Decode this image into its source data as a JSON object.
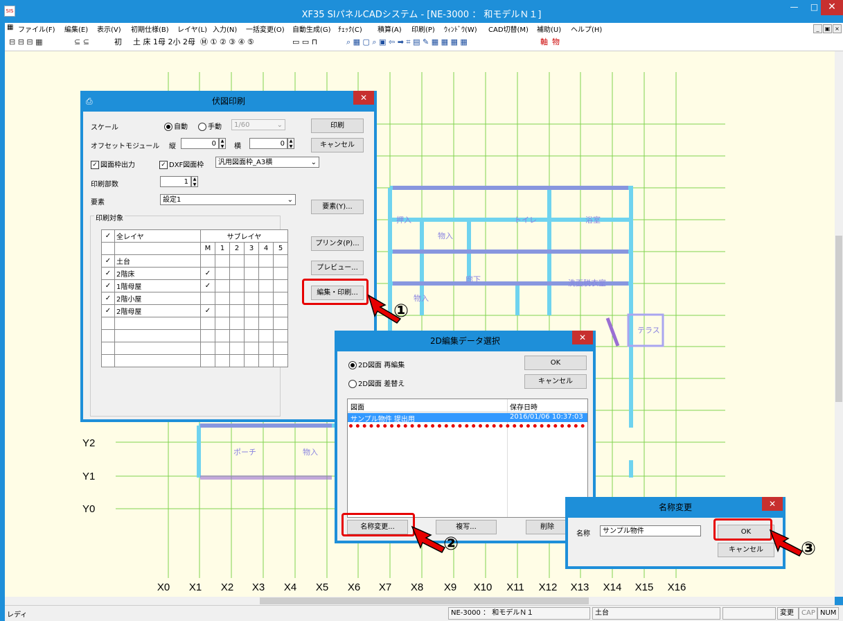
{
  "window": {
    "title": "XF35 SIパネルCADシステム - [NE-3000 ： 和モデルＮ１]",
    "app_icon": "cad-app-icon"
  },
  "menu": [
    "ファイル(F)",
    "編集(E)",
    "表示(V)",
    "初期仕様(B)",
    "レイヤ(L)",
    "入力(N)",
    "一括変更(O)",
    "自動生成(G)",
    "ﾁｪｯｸ(C)",
    "積算(A)",
    "印刷(P)",
    "ｳｨﾝﾄﾞｳ(W)",
    "CAD切替(M)",
    "補助(U)",
    "ヘルプ(H)"
  ],
  "toolbar": {
    "group1": "⊟ ⊟ ⊟ ▦",
    "group2": "⊆ ⊆",
    "item_init": "初",
    "group3": "土 床 1母 2小 2母",
    "group4": "Ⓜ ① ② ③ ④ ⑤",
    "group5": "▭ ▭ ⊓",
    "group6": "⌕ ▦ ▢ ⌕ ▣ ⇦ ➡ ⌗ ▤ ✎ ▦ ▦ ▦ ▦",
    "item_shaft": "軸",
    "item_thing": "物"
  },
  "canvas": {
    "y_labels": [
      "Y2",
      "Y1",
      "Y0"
    ],
    "x_labels": [
      "X0",
      "X1",
      "X2",
      "X3",
      "X4",
      "X5",
      "X6",
      "X7",
      "X8",
      "X9",
      "X10",
      "X11",
      "X12",
      "X13",
      "X14",
      "X15",
      "X16"
    ],
    "room_labels": [
      "押入",
      "物入",
      "トイレ",
      "浴室",
      "廊下",
      "洗面脱衣室",
      "物入",
      "テラス",
      "ポーチ",
      "物入"
    ]
  },
  "dlg_print": {
    "title": "伏図印刷",
    "scale_label": "スケール",
    "radio_auto": "自動",
    "radio_manual": "手動",
    "scale_value": "1/60",
    "offset_label": "オフセットモジュール",
    "vert_label": "縦",
    "vert_value": "0",
    "horz_label": "横",
    "horz_value": "0",
    "frame_output": "図面枠出力",
    "dxf_frame": "DXF図面枠",
    "frame_select": "汎用図面枠_A3横",
    "copies_label": "印刷部数",
    "copies_value": "1",
    "element_label": "要素",
    "element_select": "設定1",
    "target_group": "印刷対象",
    "all_layers": "全レイヤ",
    "sublayer": "サブレイヤ",
    "sub_cols": [
      "M",
      "1",
      "2",
      "3",
      "4",
      "5"
    ],
    "layers": [
      {
        "name": "土台",
        "checked": "✓",
        "m": ""
      },
      {
        "name": "2階床",
        "checked": "✓",
        "m": "✓"
      },
      {
        "name": "1階母屋",
        "checked": "✓",
        "m": "✓"
      },
      {
        "name": "2階小屋",
        "checked": "✓",
        "m": ""
      },
      {
        "name": "2階母屋",
        "checked": "✓",
        "m": "✓"
      }
    ],
    "btn_print": "印刷",
    "btn_cancel": "キャンセル",
    "btn_element": "要素(Y)...",
    "btn_printer": "プリンタ(P)...",
    "btn_preview": "プレビュー...",
    "btn_edit_print": "編集・印刷..."
  },
  "dlg_edit": {
    "title": "2D編集データ選択",
    "radio_reedit": "2D図面 再編集",
    "radio_replace": "2D図面 差替え",
    "btn_ok": "OK",
    "btn_cancel": "キャンセル",
    "col_drawing": "図面",
    "col_saved": "保存日時",
    "row_name": "サンプル物件 提出用",
    "row_date": "2016/01/06 10:37:03",
    "btn_rename": "名称変更...",
    "btn_copy": "複写...",
    "btn_delete": "削除"
  },
  "dlg_rename": {
    "title": "名称変更",
    "name_label": "名称",
    "name_value": "サンプル物件",
    "btn_ok": "OK",
    "btn_cancel": "キャンセル"
  },
  "callouts": [
    "①",
    "②",
    "③"
  ],
  "status": {
    "ready": "レディ",
    "doc": "NE-3000 ： 和モデルＮ１",
    "layer": "土台",
    "change": "変更",
    "cap": "CAP",
    "num": "NUM"
  },
  "colors": {
    "accent": "#1e8fd9",
    "highlight": "#e60000",
    "grid": "#7fd34e",
    "wall": "#6fd3ef"
  }
}
